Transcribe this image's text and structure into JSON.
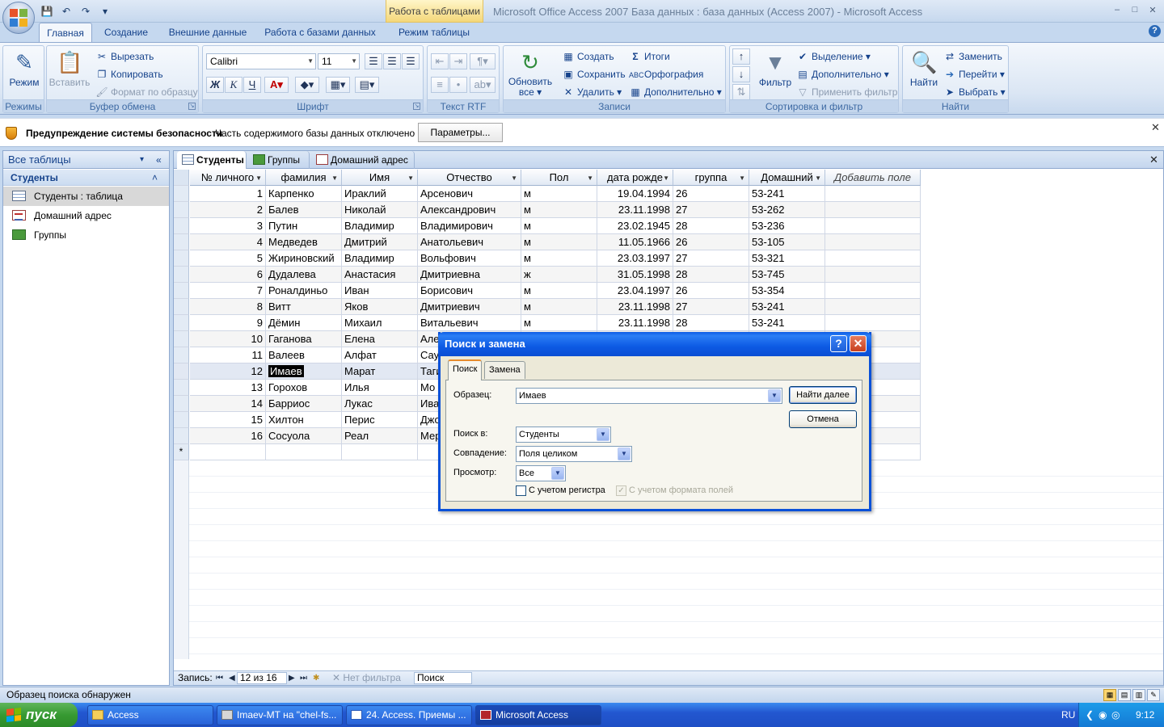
{
  "window": {
    "title": "Microsoft Office Access 2007 База данных : база данных (Access 2007) - Microsoft Access",
    "contextual_tab": "Работа с таблицами"
  },
  "ribbon": {
    "tabs": [
      "Главная",
      "Создание",
      "Внешние данные",
      "Работа с базами данных",
      "Режим таблицы"
    ],
    "groups": {
      "views": {
        "label": "Режимы",
        "mode": "Режим"
      },
      "clipboard": {
        "label": "Буфер обмена",
        "paste": "Вставить",
        "cut": "Вырезать",
        "copy": "Копировать",
        "format_painter": "Формат по образцу"
      },
      "font": {
        "label": "Шрифт",
        "font_name": "Calibri",
        "font_size": "11"
      },
      "rtf": {
        "label": "Текст RTF"
      },
      "records": {
        "label": "Записи",
        "refresh": "Обновить все",
        "refresh_line1": "Обновить",
        "refresh_line2": "все",
        "new": "Создать",
        "save": "Сохранить",
        "delete": "Удалить",
        "totals": "Итоги",
        "spelling": "Орфография",
        "more": "Дополнительно"
      },
      "sort_filter": {
        "label": "Сортировка и фильтр",
        "filter": "Фильтр",
        "selection": "Выделение",
        "advanced": "Дополнительно",
        "apply_filter": "Применить фильтр"
      },
      "find": {
        "label": "Найти",
        "find": "Найти",
        "replace": "Заменить",
        "goto": "Перейти",
        "select": "Выбрать"
      }
    }
  },
  "security_bar": {
    "title": "Предупреждение системы безопасности",
    "message": "Часть содержимого базы данных отключено",
    "button": "Параметры..."
  },
  "nav_pane": {
    "header": "Все таблицы",
    "group": "Студенты",
    "items": [
      {
        "label": "Студенты : таблица",
        "type": "table"
      },
      {
        "label": "Домашний адрес",
        "type": "form"
      },
      {
        "label": "Группы",
        "type": "report"
      }
    ]
  },
  "doc_tabs": [
    "Студенты",
    "Группы",
    "Домашний адрес"
  ],
  "table": {
    "columns": [
      "№ личного",
      "фамилия",
      "Имя",
      "Отчество",
      "Пол",
      "дата рожде",
      "группа",
      "Домашний",
      "Добавить поле"
    ],
    "rows": [
      [
        "1",
        "Карпенко",
        "Ираклий",
        "Арсенович",
        "м",
        "19.04.1994",
        "26",
        "53-241"
      ],
      [
        "2",
        "Балев",
        "Николай",
        "Александрович",
        "м",
        "23.11.1998",
        "27",
        "53-262"
      ],
      [
        "3",
        "Путин",
        "Владимир",
        "Владимирович",
        "м",
        "23.02.1945",
        "28",
        "53-236"
      ],
      [
        "4",
        "Медведев",
        "Дмитрий",
        "Анатольевич",
        "м",
        "11.05.1966",
        "26",
        "53-105"
      ],
      [
        "5",
        "Жириновский",
        "Владимир",
        "Вольфович",
        "м",
        "23.03.1997",
        "27",
        "53-321"
      ],
      [
        "6",
        "Дудалева",
        "Анастасия",
        "Дмитриевна",
        "ж",
        "31.05.1998",
        "28",
        "53-745"
      ],
      [
        "7",
        "Роналдиньо",
        "Иван",
        "Борисович",
        "м",
        "23.04.1997",
        "26",
        "53-354"
      ],
      [
        "8",
        "Витт",
        "Яков",
        "Дмитриевич",
        "м",
        "23.11.1998",
        "27",
        "53-241"
      ],
      [
        "9",
        "Дёмин",
        "Михаил",
        "Витальевич",
        "м",
        "23.11.1998",
        "28",
        "53-241"
      ],
      [
        "10",
        "Гаганова",
        "Елена",
        "Але",
        "",
        "",
        "",
        ""
      ],
      [
        "11",
        "Валеев",
        "Алфат",
        "Сау",
        "",
        "",
        "",
        ""
      ],
      [
        "12",
        "Имаев",
        "Марат",
        "Таги",
        "",
        "",
        "",
        ""
      ],
      [
        "13",
        "Горохов",
        "Илья",
        "Мо",
        "",
        "",
        "",
        ""
      ],
      [
        "14",
        "Барриос",
        "Лукас",
        "Ива",
        "",
        "",
        "",
        ""
      ],
      [
        "15",
        "Хилтон",
        "Перис",
        "Джо",
        "",
        "",
        "",
        ""
      ],
      [
        "16",
        "Сосуола",
        "Реал",
        "Мер",
        "",
        "",
        "",
        ""
      ]
    ],
    "new_row_marker": "*",
    "current_row": 12
  },
  "record_nav": {
    "label": "Запись:",
    "position": "12 из 16",
    "filter": "Нет фильтра",
    "search": "Поиск"
  },
  "find_dialog": {
    "title": "Поиск и замена",
    "tab_find": "Поиск",
    "tab_replace": "Замена",
    "pattern_label": "Образец:",
    "pattern_value": "Имаев",
    "look_in_label": "Поиск в:",
    "look_in_value": "Студенты",
    "match_label": "Совпадение:",
    "match_value": "Поля целиком",
    "search_label": "Просмотр:",
    "search_value": "Все",
    "match_case": "С учетом регистра",
    "match_format": "С учетом формата полей",
    "find_next": "Найти далее",
    "cancel": "Отмена"
  },
  "status_bar": {
    "message": "Образец поиска обнаружен"
  },
  "taskbar": {
    "start": "пуск",
    "tasks": [
      "Access",
      "Imaev-MT на \"chel-fs...",
      "24. Access. Приемы ...",
      "Microsoft Access"
    ],
    "lang": "RU",
    "clock": "9:12"
  },
  "colors": {
    "accent": "#15428b",
    "ribbon_bg": "#dbe6f4",
    "xp_blue": "#0a51d8"
  }
}
